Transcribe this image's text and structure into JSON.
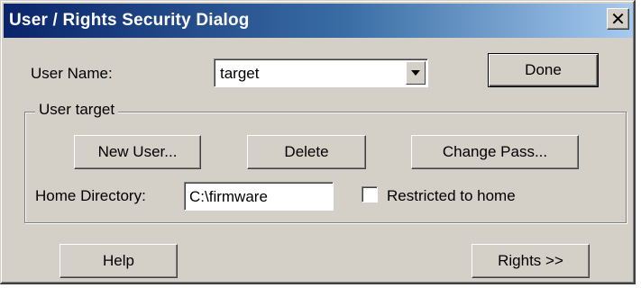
{
  "window": {
    "title": "User / Rights Security Dialog",
    "close_glyph": "✕"
  },
  "user_name": {
    "label": "User Name:",
    "selected": "target"
  },
  "buttons": {
    "done": "Done",
    "new_user": "New User...",
    "delete": "Delete",
    "change_pass": "Change Pass...",
    "help": "Help",
    "rights": "Rights >>"
  },
  "group": {
    "legend": "User target",
    "home_directory_label": "Home Directory:",
    "home_directory_value": "C:\\firmware",
    "restricted_label": "Restricted to home",
    "restricted_checked": false
  },
  "icons": {
    "close": "close-icon",
    "dropdown": "chevron-down-icon"
  }
}
